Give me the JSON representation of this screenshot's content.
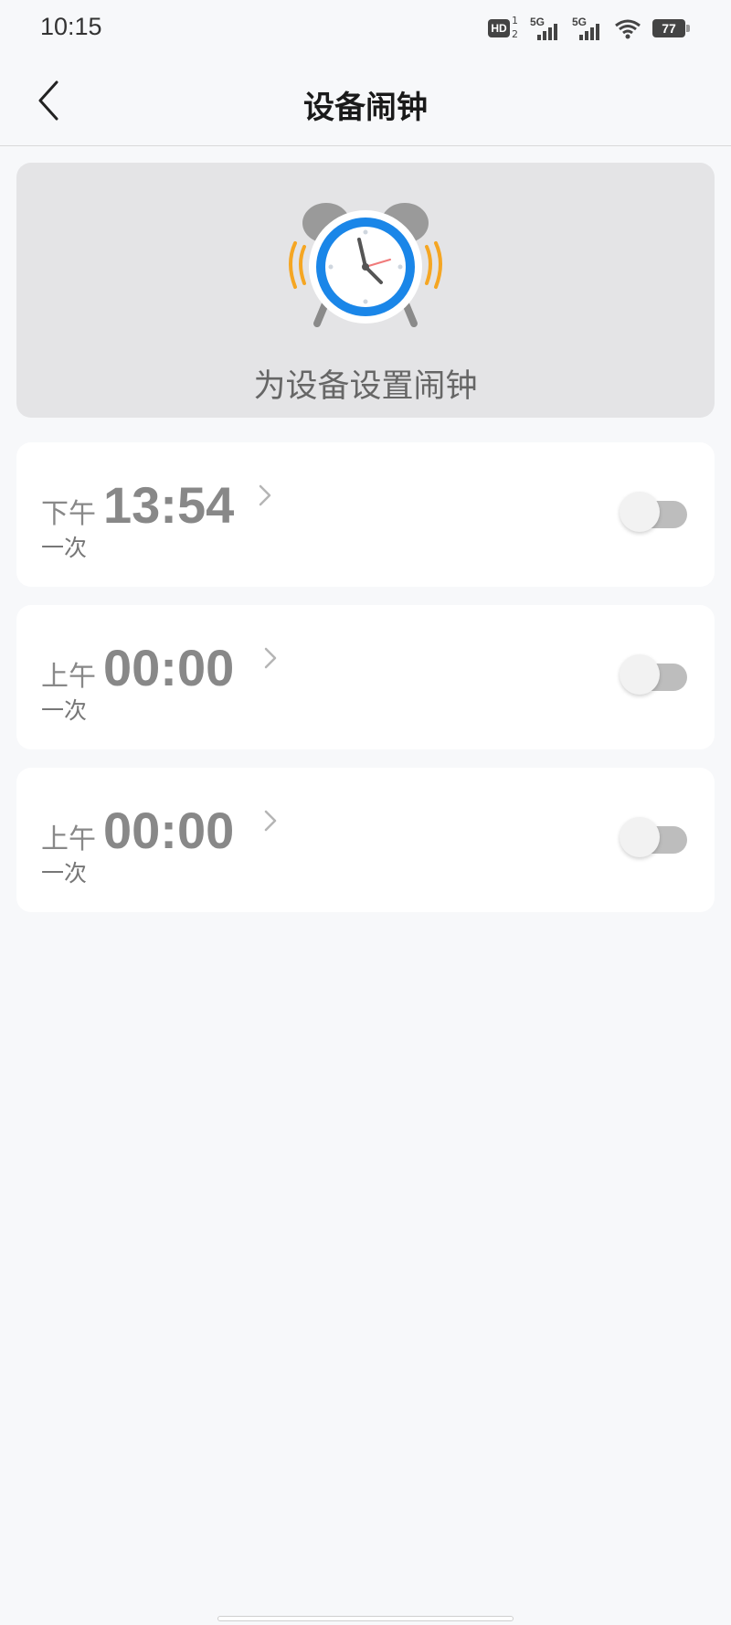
{
  "status_bar": {
    "time": "10:15",
    "hd_label": "HD",
    "hd_sub": "2",
    "hd_sup": "1",
    "signal1": "5G",
    "signal2": "5G",
    "battery": "77"
  },
  "header": {
    "title": "设备闹钟",
    "back_icon": "chevron-left-icon"
  },
  "banner": {
    "text": "为设备设置闹钟",
    "icon": "alarm-clock-icon"
  },
  "alarms": [
    {
      "period": "下午",
      "time": "13:54",
      "repeat": "一次",
      "enabled": false
    },
    {
      "period": "上午",
      "time": "00:00",
      "repeat": "一次",
      "enabled": false
    },
    {
      "period": "上午",
      "time": "00:00",
      "repeat": "一次",
      "enabled": false
    }
  ],
  "colors": {
    "background": "#f7f8fa",
    "banner_bg": "#e4e4e6",
    "card_bg": "#ffffff",
    "clock_blue": "#1a86e8",
    "accent_orange": "#f5a623",
    "toggle_off": "#bdbdbd"
  }
}
